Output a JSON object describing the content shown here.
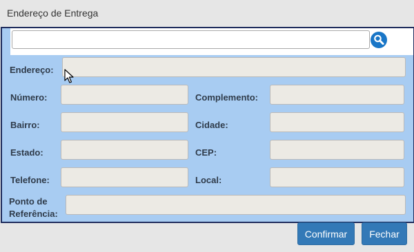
{
  "window": {
    "title": "Endereço de Entrega"
  },
  "search": {
    "value": "",
    "button_icon": "magnifier-icon"
  },
  "form": {
    "endereco_label": "Endereço:",
    "numero_label": "Número:",
    "complemento_label": "Complemento:",
    "bairro_label": "Bairro:",
    "cidade_label": "Cidade:",
    "estado_label": "Estado:",
    "cep_label": "CEP:",
    "telefone_label": "Telefone:",
    "local_label": "Local:",
    "referencia_label": "Ponto de Referência:"
  },
  "buttons": {
    "confirm": "Confirmar",
    "close": "Fechar"
  },
  "colors": {
    "panel_bg": "#a8ccf2",
    "panel_border": "#1e2b5c",
    "accent": "#3379b7",
    "search_button": "#1976c7",
    "field_bg": "#eceae4"
  }
}
